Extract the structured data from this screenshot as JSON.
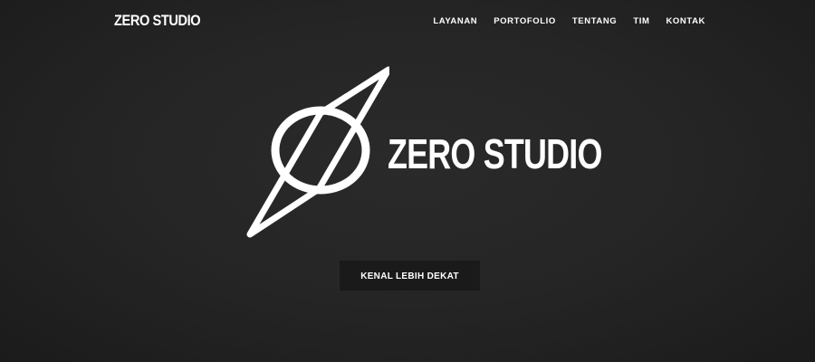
{
  "header": {
    "brand": "ZERO STUDIO",
    "nav": [
      {
        "label": "LAYANAN"
      },
      {
        "label": "PORTOFOLIO"
      },
      {
        "label": "TENTANG"
      },
      {
        "label": "TIM"
      },
      {
        "label": "KONTAK"
      }
    ]
  },
  "hero": {
    "logo_icon": "zero-slash-icon",
    "wordmark": "ZERO STUDIO",
    "cta_label": "KENAL LEBIH DEKAT"
  },
  "colors": {
    "background": "#232323",
    "text": "#ffffff",
    "button_bg": "#1a1a1a"
  }
}
